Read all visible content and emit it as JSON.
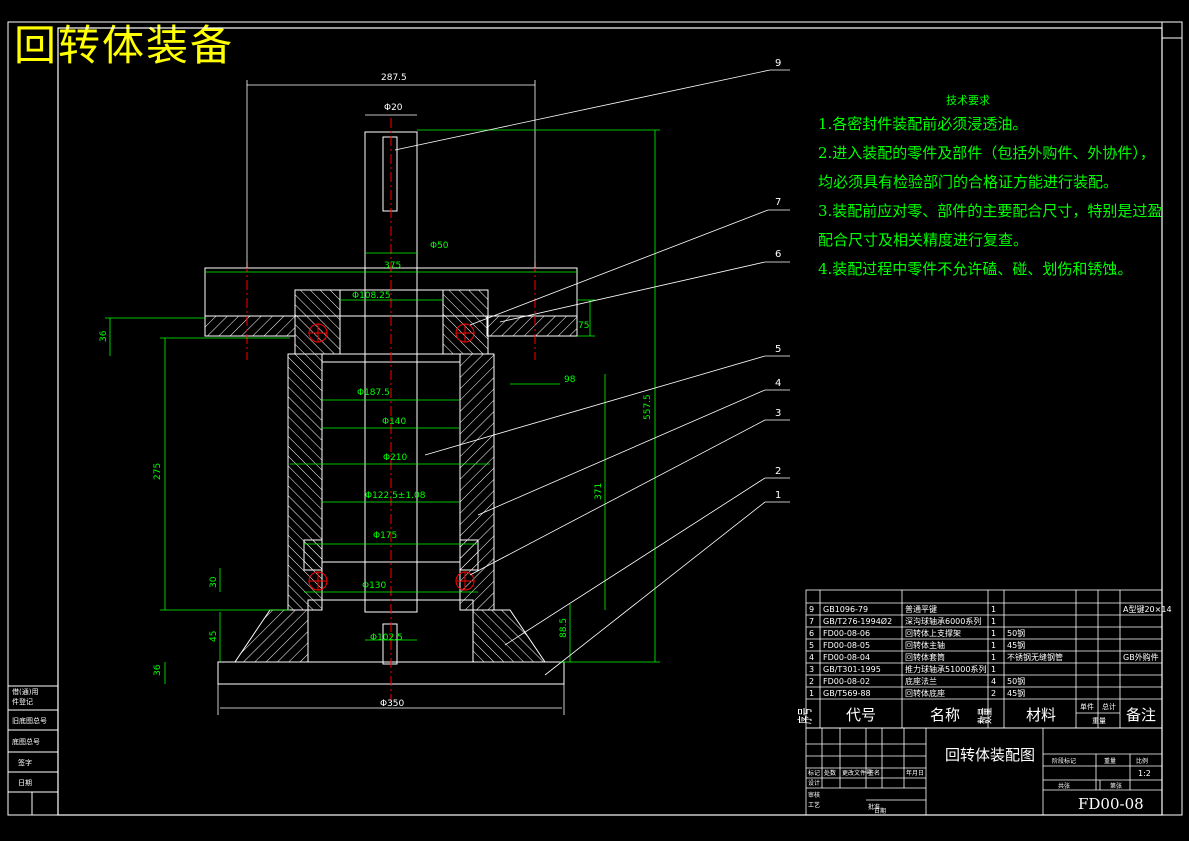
{
  "title_overlay": "回转体装备",
  "dimensions": {
    "top_width": "287.5",
    "shaft_dia": "Φ20",
    "shaft_fit": "Φ50",
    "bearing_top": "Φ108.25",
    "flange_w": "375",
    "height_total": "557.5",
    "height_side": "275",
    "inner_1": "Φ187.5",
    "inner_2": "Φ140",
    "inner_3": "Φ210",
    "inner_4": "Φ122.5±1.08",
    "inner_5": "Φ175",
    "inner_6": "Φ130",
    "inner_7": "Φ102.5",
    "base_w": "Φ350",
    "h_36": "36",
    "h_75": "75",
    "h_30": "30",
    "h_45": "45",
    "h_98": "98",
    "h_371": "371",
    "h_88": "88.5"
  },
  "callouts": [
    "9",
    "7",
    "6",
    "5",
    "4",
    "3",
    "2",
    "1"
  ],
  "tech_requirements": {
    "heading": "技术要求",
    "items": [
      "1.各密封件装配前必须浸透油。",
      "2.进入装配的零件及部件（包括外购件、外协件），",
      "均必须具有检验部门的合格证方能进行装配。",
      "3.装配前应对零、部件的主要配合尺寸，特别是过盈",
      "配合尺寸及相关精度进行复查。",
      "4.装配过程中零件不允许磕、碰、划伤和锈蚀。"
    ]
  },
  "bom": {
    "rows": [
      {
        "no": "9",
        "code": "GB1096-79",
        "name": "普通平键",
        "qty": "1",
        "mat": "",
        "note": "A型键20×14"
      },
      {
        "no": "7",
        "code": "GB/T276-1994Ø2",
        "name": "深沟球轴承6000系列",
        "qty": "1",
        "mat": "",
        "note": ""
      },
      {
        "no": "6",
        "code": "FD00-08-06",
        "name": "回转体上支撑架",
        "qty": "1",
        "mat": "50钢",
        "note": ""
      },
      {
        "no": "5",
        "code": "FD00-08-05",
        "name": "回转体主轴",
        "qty": "1",
        "mat": "45钢",
        "note": ""
      },
      {
        "no": "4",
        "code": "FD00-08-04",
        "name": "回转体套筒",
        "qty": "1",
        "mat": "不锈钢无缝钢管",
        "note": "GB外购件"
      },
      {
        "no": "3",
        "code": "GB/T301-1995",
        "name": "推力球轴承51000系列",
        "qty": "1",
        "mat": "",
        "note": ""
      },
      {
        "no": "2",
        "code": "FD00-08-02",
        "name": "底座法兰",
        "qty": "4",
        "mat": "50钢",
        "note": ""
      },
      {
        "no": "1",
        "code": "GB/T569-88",
        "name": "回转体底座",
        "qty": "2",
        "mat": "45钢",
        "note": ""
      }
    ],
    "header": {
      "no": "序号",
      "code": "代号",
      "name": "名称",
      "qty": "数量",
      "mat": "材料",
      "single": "单件",
      "total": "总计",
      "weight": "重量",
      "note": "备注"
    }
  },
  "title_block": {
    "drawing_name": "回转体装配图",
    "drawing_no": "FD00-08",
    "scale": "1:2",
    "labels": [
      "标记",
      "处数",
      "更改文件号",
      "签名",
      "年月日",
      "设计",
      "审核",
      "工艺",
      "批准",
      "日期",
      "阶段标记",
      "重量",
      "比例",
      "共张",
      "第张"
    ]
  },
  "left_strip": [
    "借(通)用",
    "件登记",
    "旧底图总号",
    "底图总号",
    "签字",
    "日期"
  ],
  "colors": {
    "line": "#ffffff",
    "dim": "#00ff00",
    "center": "#ff0000",
    "yellow": "#ffff00",
    "cyan": "#00ffff",
    "magenta": "#ff00ff"
  }
}
